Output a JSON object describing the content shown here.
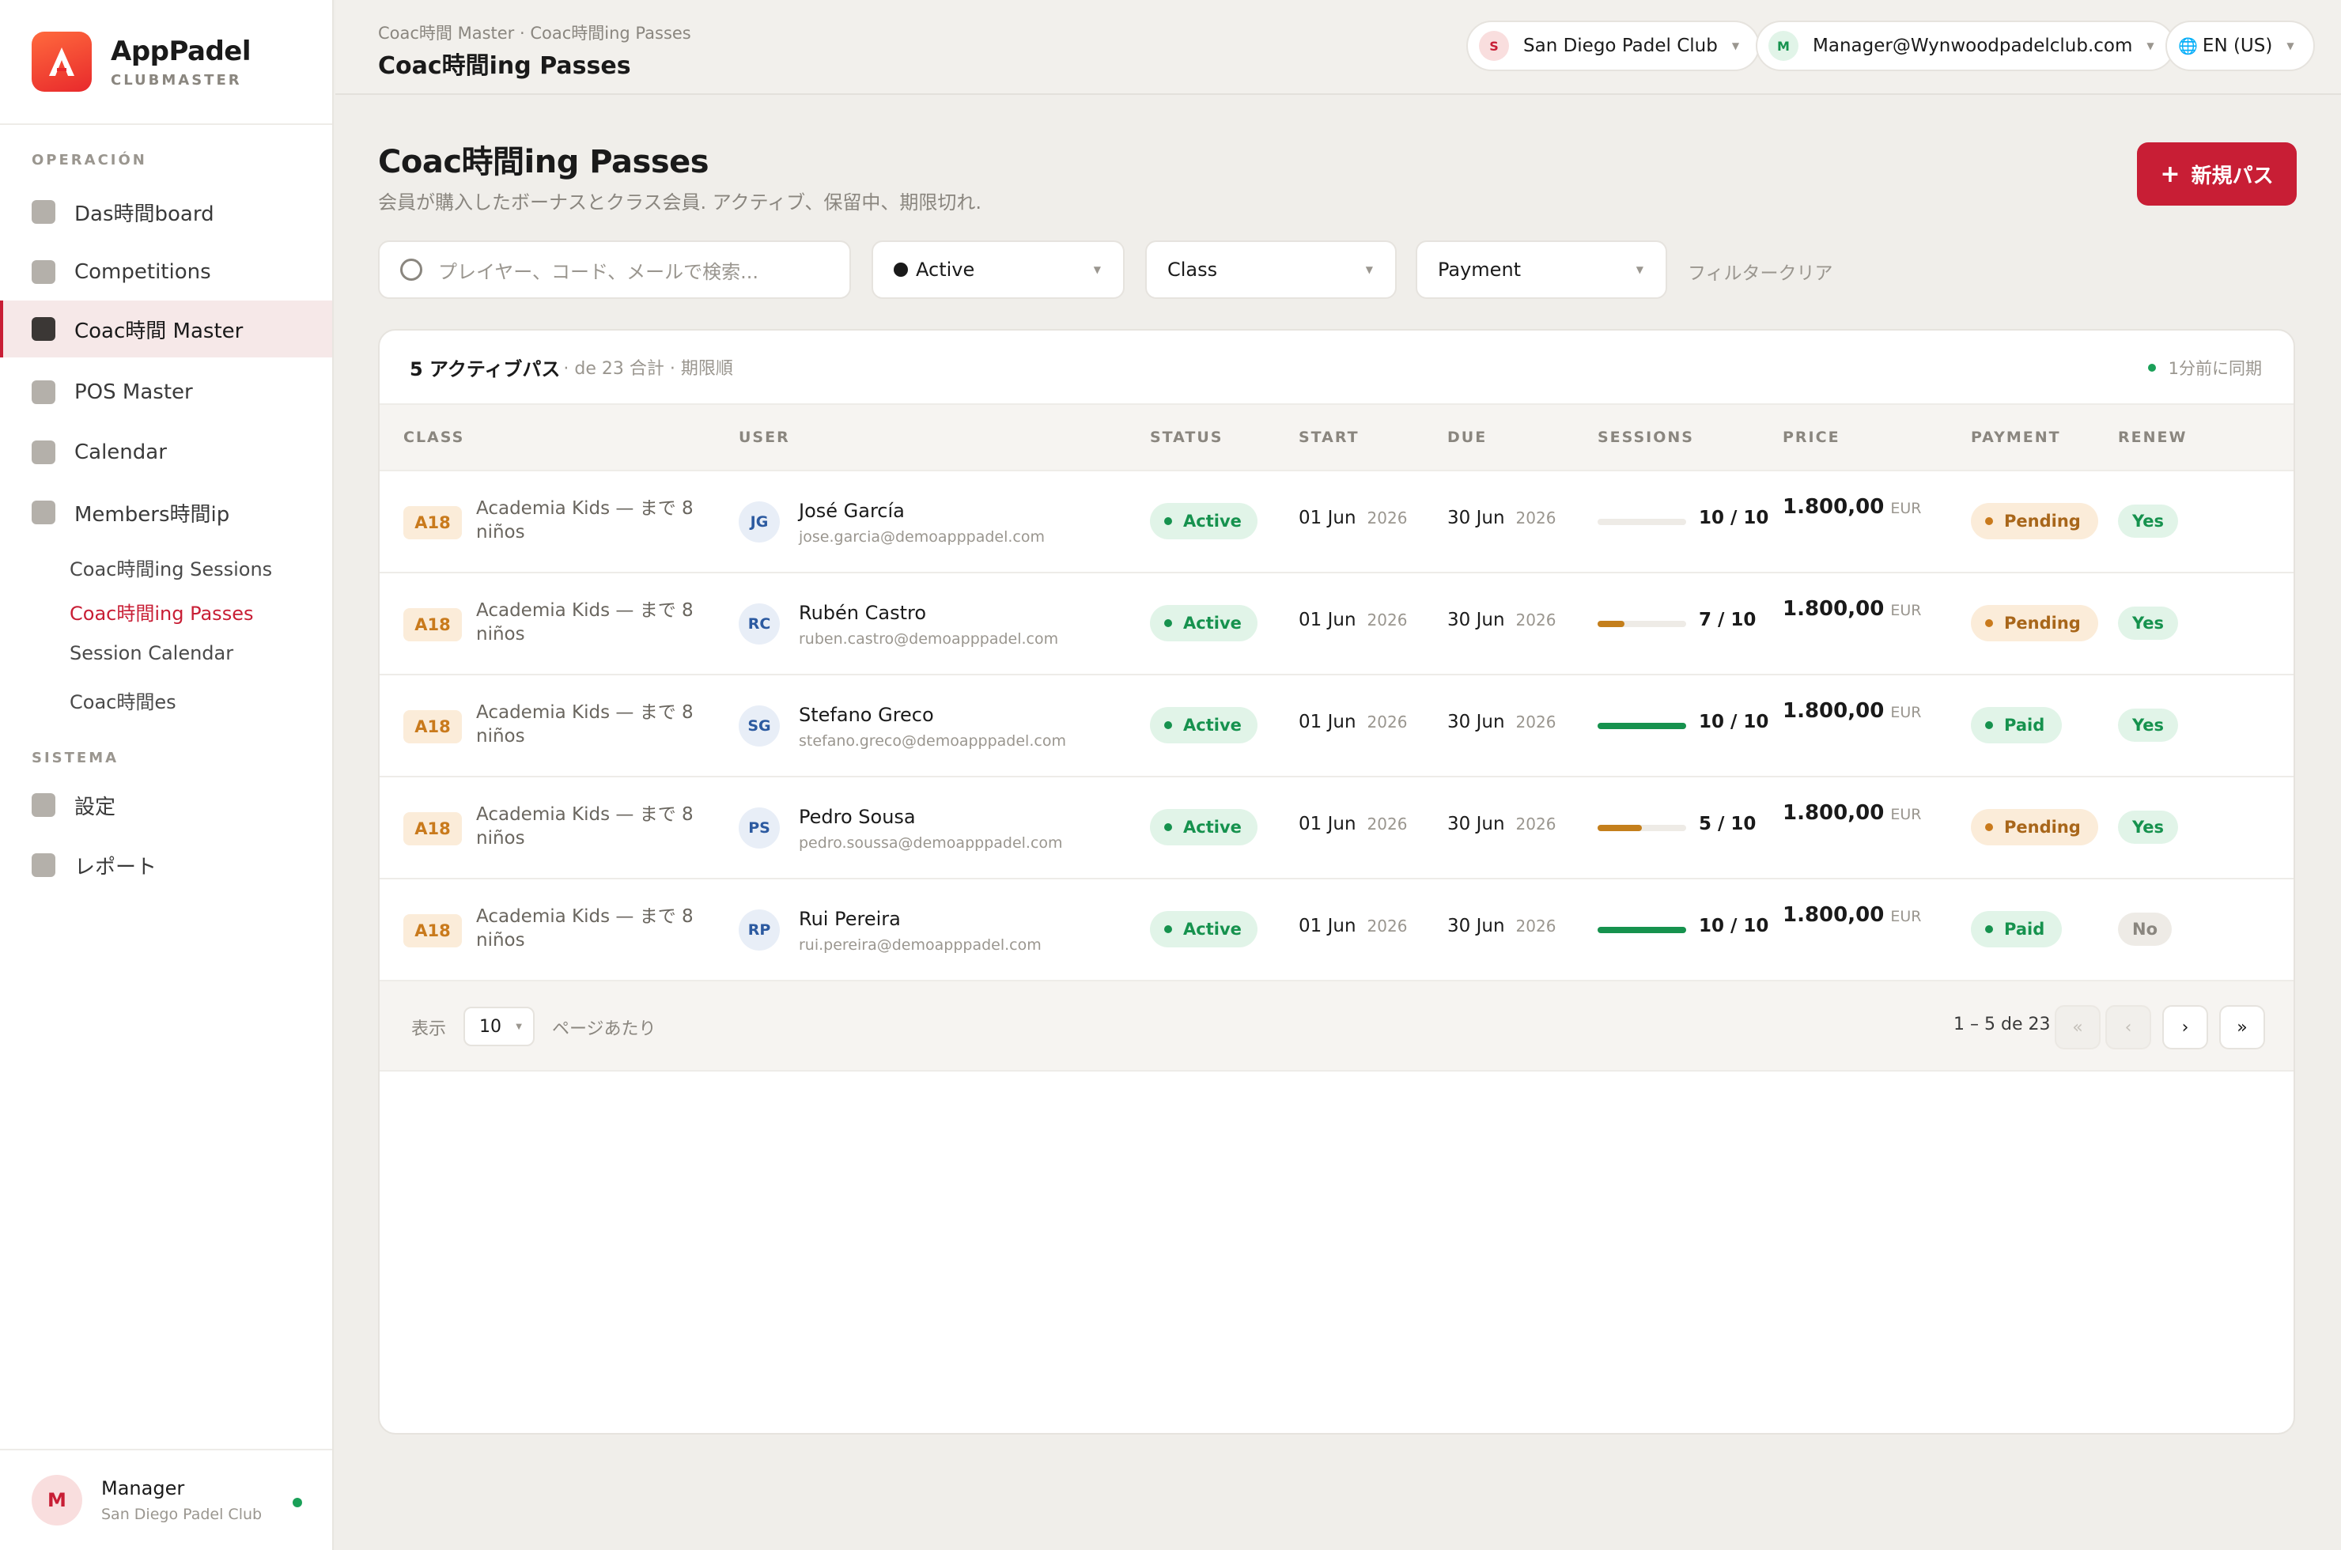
{
  "app": {
    "name": "AppPadel",
    "sub": "CLUBMASTER"
  },
  "nav": {
    "section_operacion": "OPERACIÓN",
    "section_sistema": "SISTEMA",
    "items": [
      {
        "label": "Das時間board"
      },
      {
        "label": "Competitions"
      },
      {
        "label": "Coac時間 Master"
      },
      {
        "label": "POS Master"
      },
      {
        "label": "Calendar"
      },
      {
        "label": "Members時間ip"
      }
    ],
    "sub_items": [
      {
        "label": "Coac時間ing Sessions"
      },
      {
        "label": "Coac時間ing Passes"
      },
      {
        "label": "Session Calendar"
      },
      {
        "label": "Coac時間es"
      }
    ],
    "system_items": [
      {
        "label": "設定"
      },
      {
        "label": "レポート"
      }
    ]
  },
  "user": {
    "initial": "M",
    "name": "Manager",
    "club": "San Diego Padel Club"
  },
  "header": {
    "breadcrumb": "Coac時間 Master · Coac時間ing Passes",
    "title": "Coac時間ing Passes",
    "club": {
      "initial": "S",
      "name": "San Diego Padel Club"
    },
    "account": {
      "initial": "M",
      "email": "Manager@Wynwoodpadelclub.com"
    },
    "language": "EN (US)"
  },
  "page": {
    "title": "Coac時間ing Passes",
    "subtitle": "会員が購入したボーナスとクラス会員. アクティブ、保留中、期限切れ.",
    "new_button": "新規パス"
  },
  "filters": {
    "search_placeholder": "プレイヤー、コード、メールで検索...",
    "status_value": "Active",
    "class_value": "Class",
    "payment_value": "Payment",
    "clear": "フィルタークリア"
  },
  "summary": {
    "count": "5 アクティブパス",
    "meta": "· de 23 合計 · 期限順",
    "sync": "1分前に同期"
  },
  "columns": [
    "CLASS",
    "USER",
    "STATUS",
    "START",
    "DUE",
    "SESSIONS",
    "PRICE",
    "PAYMENT",
    "RENEW"
  ],
  "rows": [
    {
      "code": "A18",
      "class_name": "Academia Kids — まで 8 niños",
      "initials": "JG",
      "name": "José García",
      "email": "jose.garcia@demoapppadel.com",
      "status": "Active",
      "start_day": "01 Jun",
      "start_year": "2026",
      "due_day": "30 Jun",
      "due_year": "2026",
      "sessions": "10 / 10",
      "progress": 0.0,
      "price": "1.800,00",
      "currency": "EUR",
      "payment": "Pending",
      "renew": "Yes"
    },
    {
      "code": "A18",
      "class_name": "Academia Kids — まで 8 niños",
      "initials": "RC",
      "name": "Rubén Castro",
      "email": "ruben.castro@demoapppadel.com",
      "status": "Active",
      "start_day": "01 Jun",
      "start_year": "2026",
      "due_day": "30 Jun",
      "due_year": "2026",
      "sessions": "7 / 10",
      "progress": 0.3,
      "price": "1.800,00",
      "currency": "EUR",
      "payment": "Pending",
      "renew": "Yes"
    },
    {
      "code": "A18",
      "class_name": "Academia Kids — まで 8 niños",
      "initials": "SG",
      "name": "Stefano Greco",
      "email": "stefano.greco@demoapppadel.com",
      "status": "Active",
      "start_day": "01 Jun",
      "start_year": "2026",
      "due_day": "30 Jun",
      "due_year": "2026",
      "sessions": "10 / 10",
      "progress": 1.0,
      "price": "1.800,00",
      "currency": "EUR",
      "payment": "Paid",
      "renew": "Yes"
    },
    {
      "code": "A18",
      "class_name": "Academia Kids — まで 8 niños",
      "initials": "PS",
      "name": "Pedro Sousa",
      "email": "pedro.soussa@demoapppadel.com",
      "status": "Active",
      "start_day": "01 Jun",
      "start_year": "2026",
      "due_day": "30 Jun",
      "due_year": "2026",
      "sessions": "5 / 10",
      "progress": 0.5,
      "price": "1.800,00",
      "currency": "EUR",
      "payment": "Pending",
      "renew": "Yes"
    },
    {
      "code": "A18",
      "class_name": "Academia Kids — まで 8 niños",
      "initials": "RP",
      "name": "Rui Pereira",
      "email": "rui.pereira@demoapppadel.com",
      "status": "Active",
      "start_day": "01 Jun",
      "start_year": "2026",
      "due_day": "30 Jun",
      "due_year": "2026",
      "sessions": "10 / 10",
      "progress": 1.0,
      "price": "1.800,00",
      "currency": "EUR",
      "payment": "Paid",
      "renew": "No"
    }
  ],
  "pagination": {
    "show_label": "表示",
    "per_page": "10",
    "per_page_suffix": "ページあたり",
    "range": "1 – 5 de 23",
    "first": "«",
    "prev": "‹",
    "next": "›",
    "last": "»"
  },
  "colors": {
    "accent": "#c81e35",
    "progress_full": "#16924e",
    "progress_partial": "#c47f1c"
  }
}
